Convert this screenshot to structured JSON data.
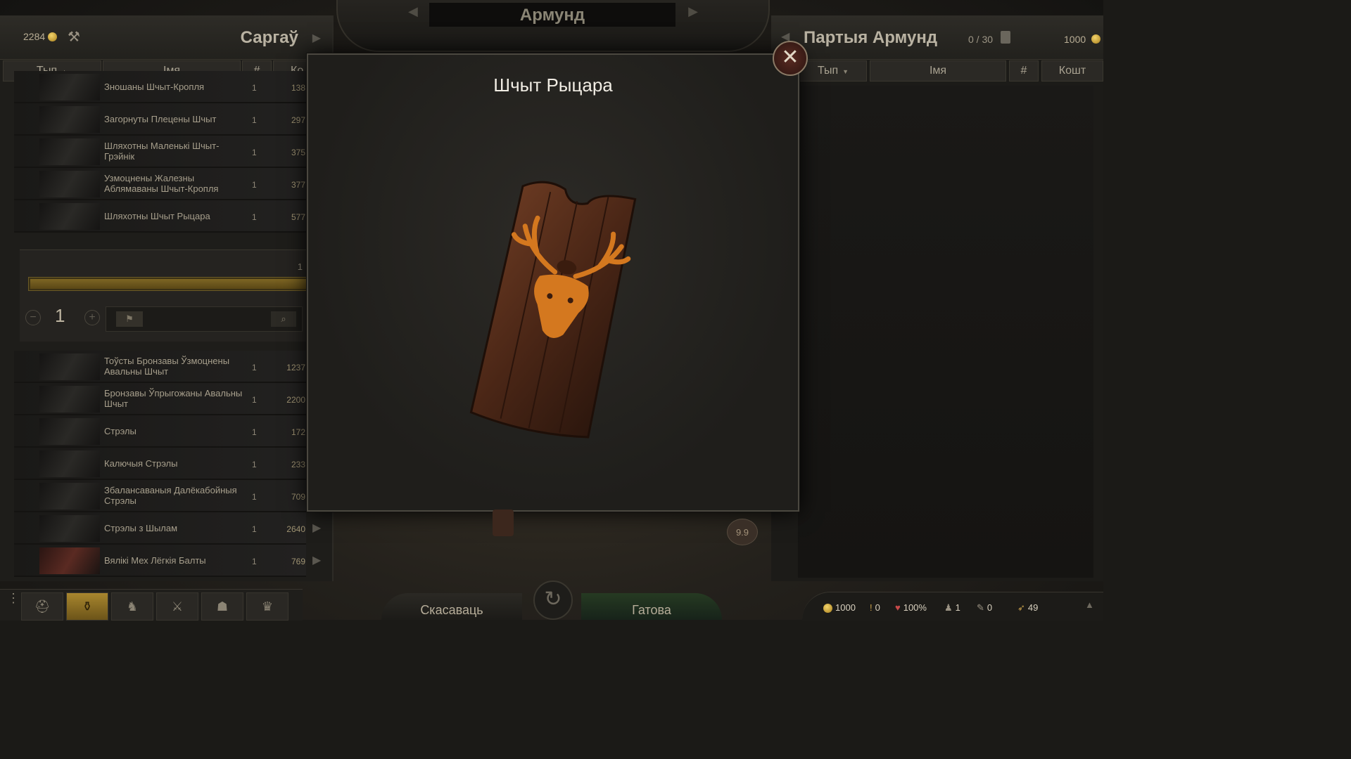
{
  "banner": {
    "title": "Армунд"
  },
  "left": {
    "gold": "2284",
    "title": "Саргаў",
    "columns": {
      "type": "Тып",
      "name": "Імя",
      "count": "#",
      "cost": "Ко"
    },
    "items_top": [
      {
        "name": "Зношаны Шчыт-Кропля",
        "count": "1",
        "price": "138"
      },
      {
        "name": "Загорнуты Плецены Шчыт",
        "count": "1",
        "price": "297"
      },
      {
        "name": "Шляхотны Маленькі Шчыт-Грэйнік",
        "count": "1",
        "price": "375"
      },
      {
        "name": "Узмоцнены Жалезны Аблямаваны Шчыт-Кропля",
        "count": "1",
        "price": "377"
      },
      {
        "name": "Шляхотны Шчыт Рыцара",
        "count": "1",
        "price": "577"
      }
    ],
    "trade": {
      "count_label": "1",
      "quantity": "1",
      "slider_fraction": 1.0
    },
    "items_bottom": [
      {
        "name": "Тоўсты Бронзавы Ўзмоцнены Авальны Шчыт",
        "count": "1",
        "price": "1237"
      },
      {
        "name": "Бронзавы Ўпрыгожаны Авальны Шчыт",
        "count": "1",
        "price": "2200"
      },
      {
        "name": "Стрэлы",
        "count": "1",
        "price": "172"
      },
      {
        "name": "Калючыя Стрэлы",
        "count": "1",
        "price": "233"
      },
      {
        "name": "Збалансаваныя Далёкабойныя Стрэлы",
        "count": "1",
        "price": "709"
      },
      {
        "name": "Стрэлы з Шылам",
        "count": "1",
        "price": "2640"
      },
      {
        "name": "Вялікі Мех Лёгкія Балты",
        "count": "1",
        "price": "769"
      }
    ]
  },
  "right": {
    "title": "Партыя Армунд",
    "capacity": "0 / 30",
    "gold": "1000",
    "columns": {
      "type": "Тып",
      "name": "Імя",
      "count": "#",
      "cost": "Кошт"
    }
  },
  "modal": {
    "title": "Шчыт Рыцара",
    "close_icon": "close-x-icon"
  },
  "weight": "9.9",
  "buttons": {
    "cancel": "Скасаваць",
    "done": "Гатова"
  },
  "status": {
    "gold": "1000",
    "influence": "0",
    "morale": "100%",
    "troops": "1",
    "food": "0",
    "speed": "49"
  },
  "colors": {
    "gold": "#f2d36a",
    "active_tab": "#a8862e",
    "modal_title": "#f1ede4"
  }
}
